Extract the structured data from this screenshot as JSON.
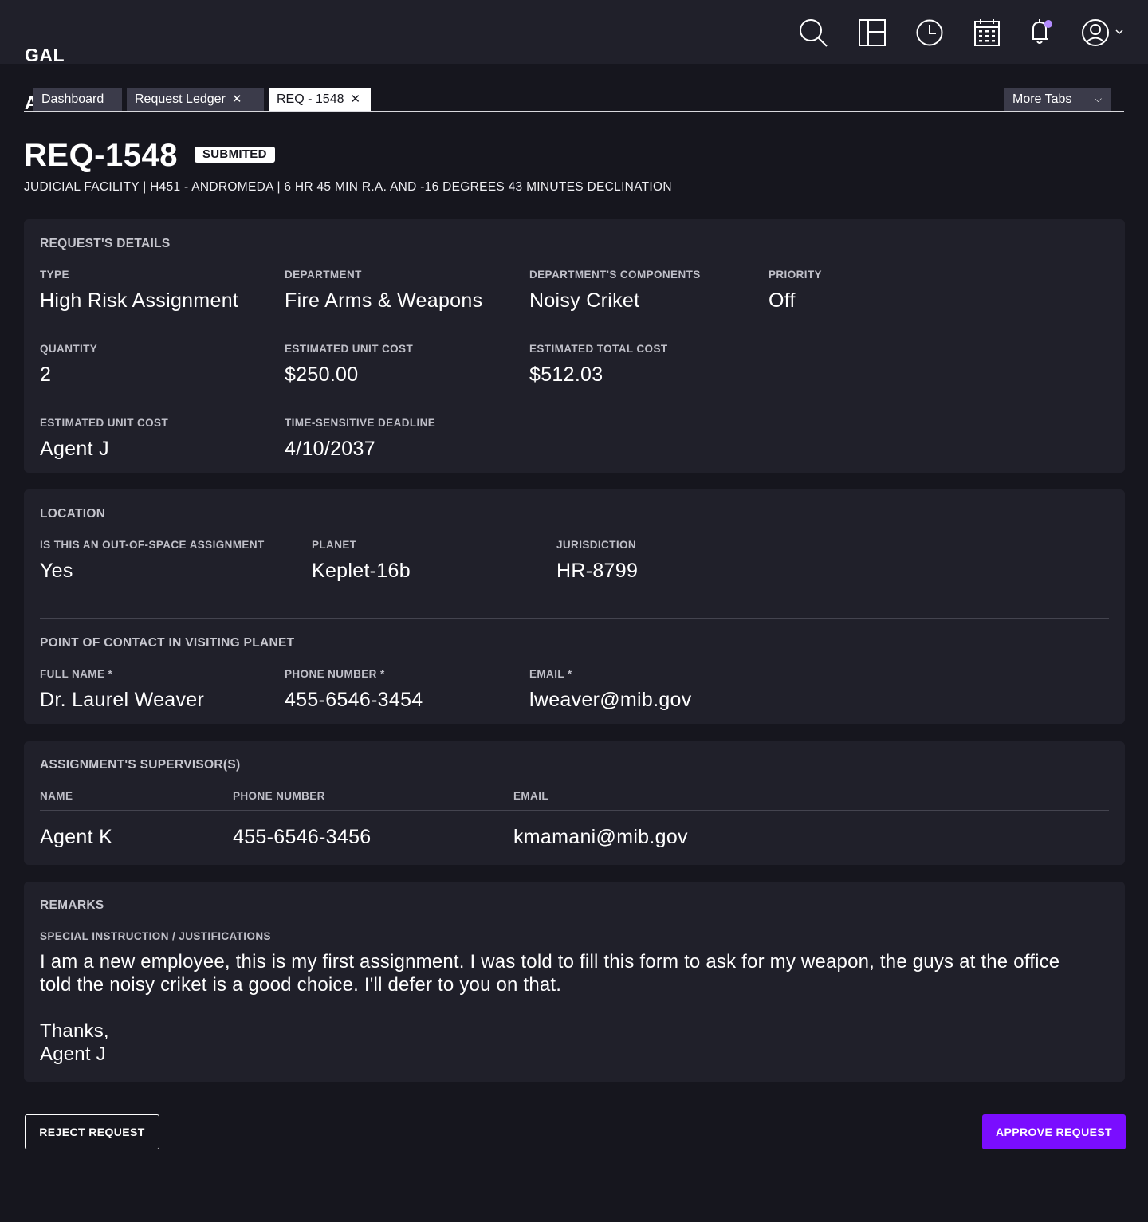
{
  "app": {
    "logo_line1": "GAL",
    "logo_line2": "AXY",
    "accent_color": "#7a0dff",
    "notification_dot_color": "#b38bff"
  },
  "topbar_icons": [
    "search-icon",
    "layout-icon",
    "clock-icon",
    "calendar-icon",
    "bell-icon",
    "user-avatar-icon",
    "chevron-down-icon"
  ],
  "tabs": [
    {
      "label": "Dashboard",
      "closable": false,
      "active": false
    },
    {
      "label": "Request Ledger",
      "closable": true,
      "active": false
    },
    {
      "label": "REQ - 1548",
      "closable": true,
      "active": true
    }
  ],
  "more_tabs_label": "More Tabs",
  "header": {
    "title": "REQ-1548",
    "status": "SUBMITED",
    "subline": "JUDICIAL FACILITY  |  H451 - ANDROMEDA  | 6 HR 45 MIN R.A. AND -16 DEGREES 43 MINUTES DECLINATION"
  },
  "details": {
    "title": "REQUEST'S DETAILS",
    "type_label": "TYPE",
    "type_value": "High Risk Assignment",
    "department_label": "DEPARTMENT",
    "department_value": "Fire Arms & Weapons",
    "components_label": "DEPARTMENT'S COMPONENTS",
    "components_value": "Noisy Criket",
    "priority_label": "PRIORITY",
    "priority_value": "Off",
    "quantity_label": "QUANTITY",
    "quantity_value": "2",
    "unit_cost_label": "ESTIMATED UNIT COST",
    "unit_cost_value": "$250.00",
    "total_cost_label": "ESTIMATED TOTAL COST",
    "total_cost_value": "$512.03",
    "requester_label": "ESTIMATED UNIT COST",
    "requester_value": "Agent J",
    "deadline_label": "TIME-SENSITIVE DEADLINE",
    "deadline_value": "4/10/2037"
  },
  "location": {
    "title": "LOCATION",
    "out_of_space_label": "IS THIS AN OUT-OF-SPACE ASSIGNMENT",
    "out_of_space_value": "Yes",
    "planet_label": "PLANET",
    "planet_value": "Keplet-16b",
    "jurisdiction_label": "JURISDICTION",
    "jurisdiction_value": "HR-8799",
    "contact_title": "POINT OF CONTACT IN VISITING PLANET",
    "full_name_label": "FULL NAME *",
    "full_name_value": "Dr. Laurel Weaver",
    "phone_label": "PHONE NUMBER *",
    "phone_value": "455-6546-3454",
    "email_label": "EMAIL *",
    "email_value": "lweaver@mib.gov"
  },
  "supervisors": {
    "title": "ASSIGNMENT'S SUPERVISOR(S)",
    "columns": [
      "NAME",
      "PHONE NUMBER",
      "EMAIL"
    ],
    "rows": [
      [
        "Agent K",
        "455-6546-3456",
        "kmamani@mib.gov"
      ]
    ]
  },
  "remarks": {
    "title": "REMARKS",
    "label": "SPECIAL INSTRUCTION / JUSTIFICATIONS",
    "line1": "I am a new employee, this is my first assignment. I was told to fill this form to ask for my weapon, the guys at the office told the noisy criket is a good choice. I'll defer to you on that.",
    "line2": "Thanks,",
    "line3": "Agent J"
  },
  "actions": {
    "reject_label": "REJECT REQUEST",
    "approve_label": "APPROVE REQUEST"
  }
}
